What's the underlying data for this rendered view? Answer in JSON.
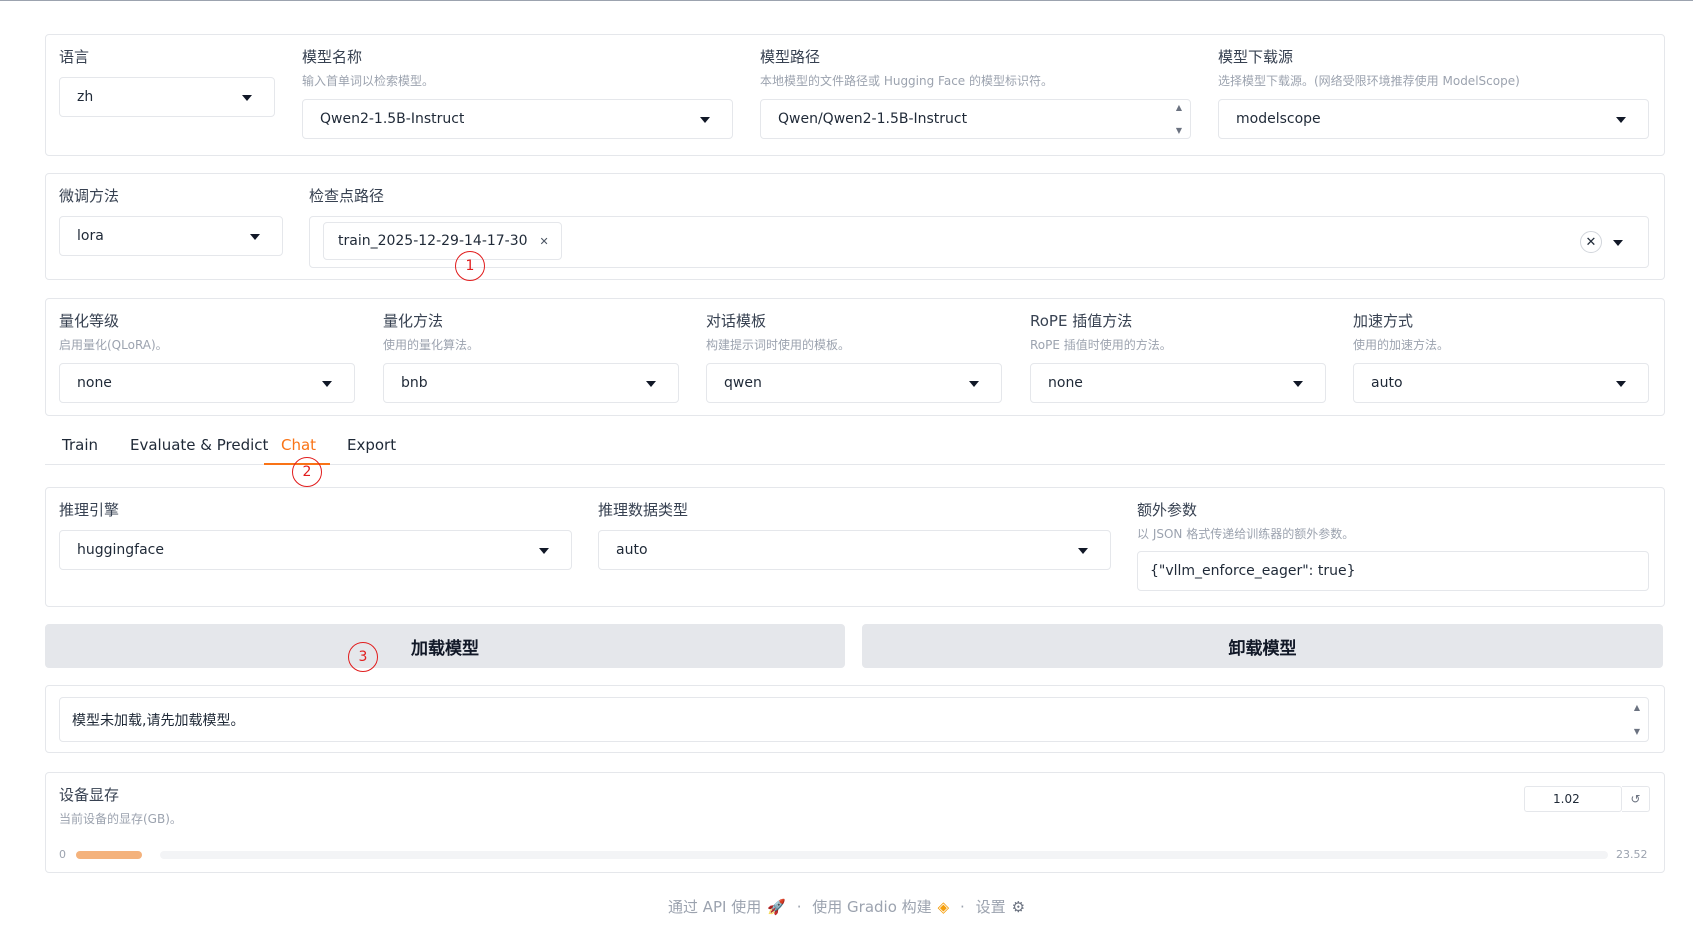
{
  "top": {
    "lang": {
      "label": "语言",
      "value": "zh"
    },
    "model_name": {
      "label": "模型名称",
      "info": "输入首单词以检索模型。",
      "value": "Qwen2-1.5B-Instruct"
    },
    "model_path": {
      "label": "模型路径",
      "info": "本地模型的文件路径或 Hugging Face 的模型标识符。",
      "value": "Qwen/Qwen2-1.5B-Instruct"
    },
    "hub": {
      "label": "模型下载源",
      "info": "选择模型下载源。(网络受限环境推荐使用 ModelScope)",
      "value": "modelscope"
    }
  },
  "finetune": {
    "method": {
      "label": "微调方法",
      "value": "lora"
    },
    "checkpoint": {
      "label": "检查点路径",
      "chips": [
        "train_2025-12-29-14-17-30"
      ]
    }
  },
  "advanced": {
    "quant_bit": {
      "label": "量化等级",
      "info": "启用量化(QLoRA)。",
      "value": "none"
    },
    "quant_method": {
      "label": "量化方法",
      "info": "使用的量化算法。",
      "value": "bnb"
    },
    "template": {
      "label": "对话模板",
      "info": "构建提示词时使用的模板。",
      "value": "qwen"
    },
    "rope": {
      "label": "RoPE 插值方法",
      "info": "RoPE 插值时使用的方法。",
      "value": "none"
    },
    "booster": {
      "label": "加速方式",
      "info": "使用的加速方法。",
      "value": "auto"
    }
  },
  "tabs": [
    {
      "label": "Train",
      "active": false
    },
    {
      "label": "Evaluate & Predict",
      "active": false
    },
    {
      "label": "Chat",
      "active": true
    },
    {
      "label": "Export",
      "active": false
    }
  ],
  "chat": {
    "backend": {
      "label": "推理引擎",
      "value": "huggingface"
    },
    "dtype": {
      "label": "推理数据类型",
      "value": "auto"
    },
    "extra": {
      "label": "额外参数",
      "info": "以 JSON 格式传递给训练器的额外参数。",
      "value": "{\"vllm_enforce_eager\": true}"
    },
    "load_button": "加载模型",
    "unload_button": "卸载模型",
    "status": "模型未加载,请先加载模型。"
  },
  "memory": {
    "label": "设备显存",
    "info": "当前设备的显存(GB)。",
    "value": "1.02",
    "min": "0",
    "max": "23.52",
    "fraction": 0.043
  },
  "markers": [
    "1",
    "2",
    "3"
  ],
  "footer": {
    "api": "通过 API 使用",
    "gradio": "使用 Gradio 构建",
    "settings": "设置",
    "sep": "·"
  },
  "colors": {
    "accent": "#f97316",
    "marker": "#e11d1d",
    "slider_fill": "#f4b27c"
  }
}
